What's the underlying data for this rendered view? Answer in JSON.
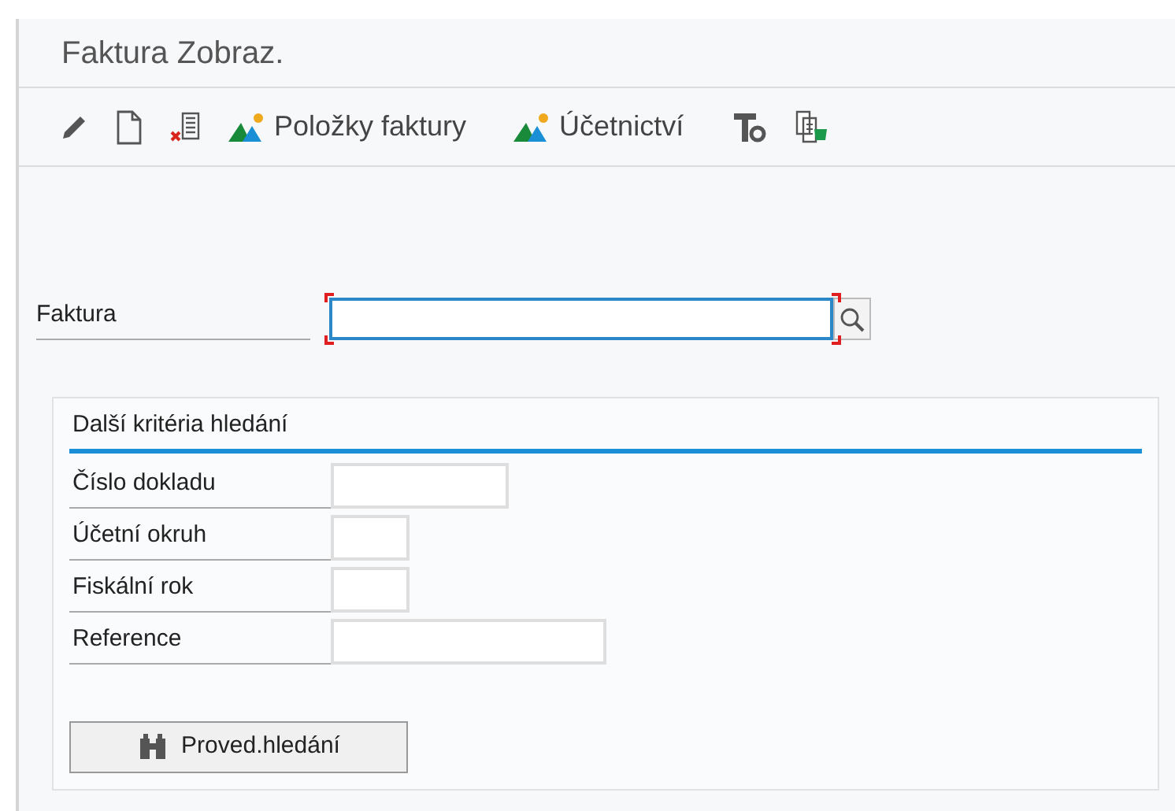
{
  "window": {
    "title": "Faktura Zobraz."
  },
  "toolbar": [
    {
      "kind": "pencil"
    },
    {
      "kind": "page"
    },
    {
      "kind": "delete"
    },
    {
      "kind": "mountain",
      "label": "Položky faktury"
    },
    {
      "kind": "mountain",
      "label": "Účetnictví"
    },
    {
      "kind": "tools"
    },
    {
      "kind": "copy"
    }
  ],
  "main_field": {
    "label": "Faktura",
    "required": true
  },
  "search_group": {
    "title": "Další kritéria hledání",
    "fields": [
      {
        "label": "Číslo dokladu",
        "kind": "medium"
      },
      {
        "label": "Účetní okruh",
        "kind": "short"
      },
      {
        "label": "Fiskální rok",
        "kind": "short"
      },
      {
        "label": "Reference",
        "kind": "long"
      }
    ],
    "button": {
      "label": "Proved.hledání"
    }
  }
}
